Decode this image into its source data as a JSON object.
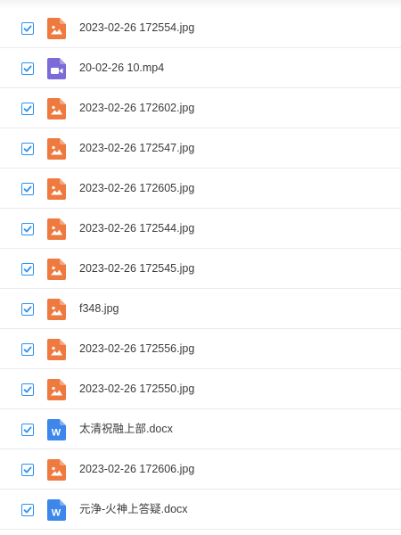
{
  "file_list": {
    "files": [
      {
        "name": "2023-02-26 172554.jpg",
        "type": "image",
        "icon": "image-file-icon",
        "checked": true
      },
      {
        "name": "20-02-26 10.mp4",
        "type": "video",
        "icon": "video-file-icon",
        "checked": true
      },
      {
        "name": "2023-02-26 172602.jpg",
        "type": "image",
        "icon": "image-file-icon",
        "checked": true
      },
      {
        "name": "2023-02-26 172547.jpg",
        "type": "image",
        "icon": "image-file-icon",
        "checked": true
      },
      {
        "name": "2023-02-26 172605.jpg",
        "type": "image",
        "icon": "image-file-icon",
        "checked": true
      },
      {
        "name": "2023-02-26 172544.jpg",
        "type": "image",
        "icon": "image-file-icon",
        "checked": true
      },
      {
        "name": "2023-02-26 172545.jpg",
        "type": "image",
        "icon": "image-file-icon",
        "checked": true
      },
      {
        "name": "f348.jpg",
        "type": "image",
        "icon": "image-file-icon",
        "checked": true
      },
      {
        "name": "2023-02-26 172556.jpg",
        "type": "image",
        "icon": "image-file-icon",
        "checked": true
      },
      {
        "name": "2023-02-26 172550.jpg",
        "type": "image",
        "icon": "image-file-icon",
        "checked": true
      },
      {
        "name": "太清祝融上部.docx",
        "type": "word",
        "icon": "word-file-icon",
        "checked": true
      },
      {
        "name": "2023-02-26 172606.jpg",
        "type": "image",
        "icon": "image-file-icon",
        "checked": true
      },
      {
        "name": "元浄-火神上答疑.docx",
        "type": "word",
        "icon": "word-file-icon",
        "checked": true
      }
    ]
  },
  "icon_labels": {
    "word": "W"
  },
  "colors": {
    "checkbox": "#2b93f0",
    "image_icon": "#ef7a3f",
    "video_icon": "#7b6bd8",
    "word_icon": "#3d86ea",
    "text": "#3b3b3b",
    "row_border": "#ebebeb"
  }
}
